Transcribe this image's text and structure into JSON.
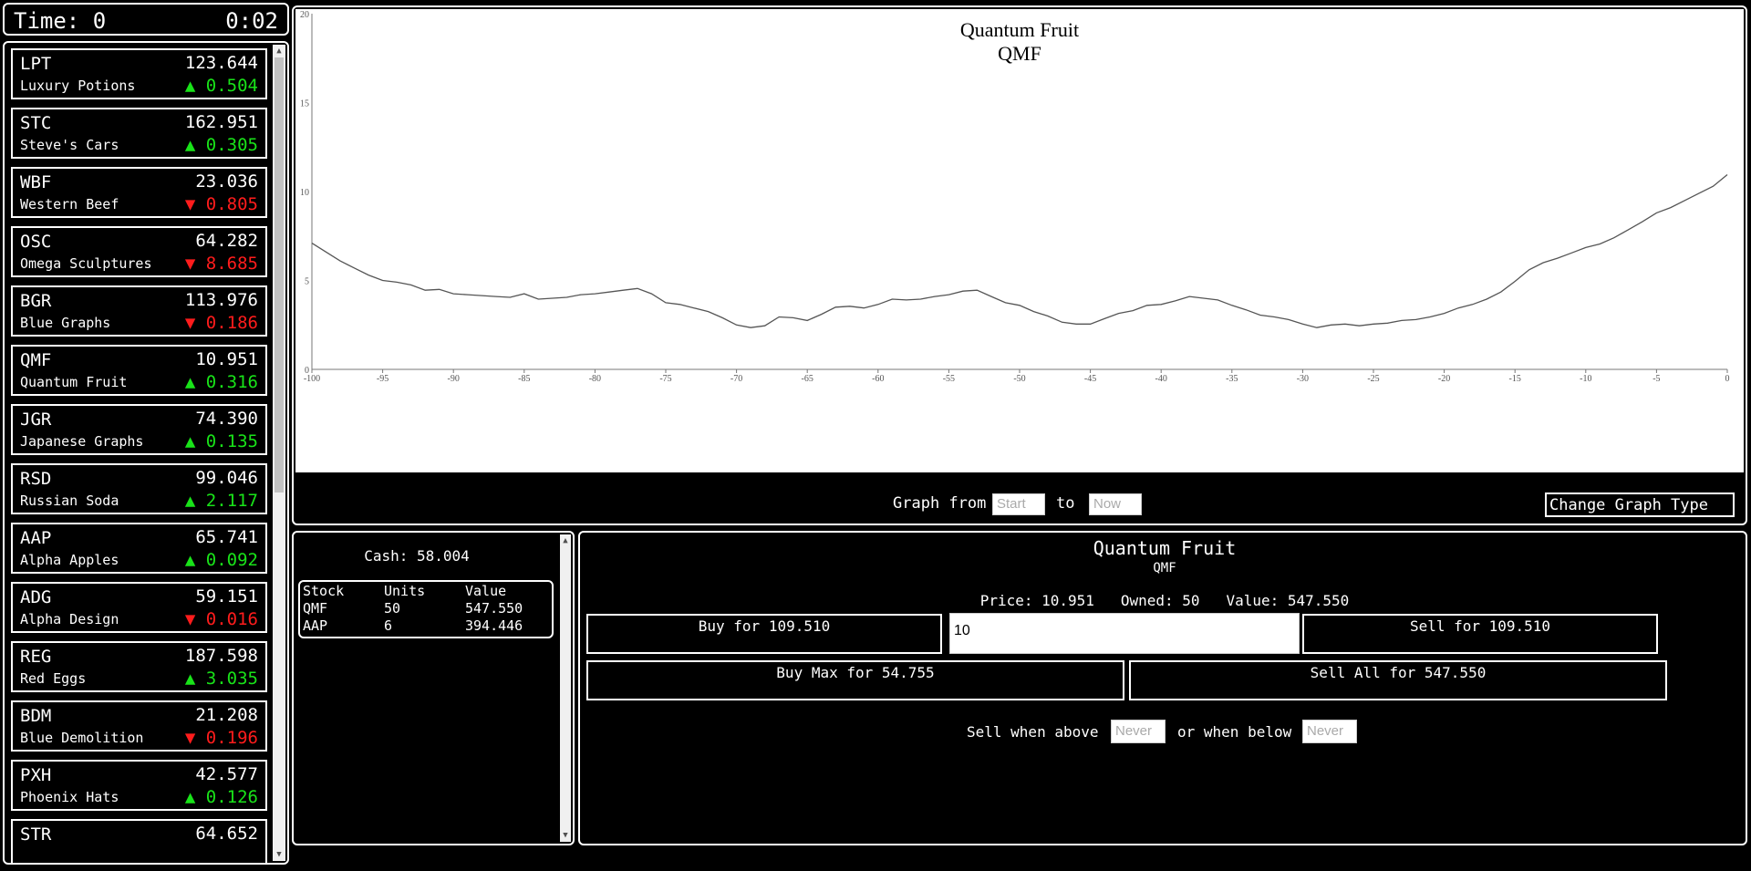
{
  "time": {
    "label": "Time: 0",
    "clock": "0:02"
  },
  "colors": {
    "up": "#19e319",
    "down": "#ff1c1c",
    "background": "#000000",
    "foreground": "#ffffff"
  },
  "stocks": [
    {
      "symbol": "LPT",
      "name": "Luxury Potions",
      "price": "123.644",
      "change": "0.504",
      "direction": "up"
    },
    {
      "symbol": "STC",
      "name": "Steve's Cars",
      "price": "162.951",
      "change": "0.305",
      "direction": "up"
    },
    {
      "symbol": "WBF",
      "name": "Western Beef",
      "price": "23.036",
      "change": "0.805",
      "direction": "down"
    },
    {
      "symbol": "OSC",
      "name": "Omega Sculptures",
      "price": "64.282",
      "change": "8.685",
      "direction": "down"
    },
    {
      "symbol": "BGR",
      "name": "Blue Graphs",
      "price": "113.976",
      "change": "0.186",
      "direction": "down"
    },
    {
      "symbol": "QMF",
      "name": "Quantum Fruit",
      "price": "10.951",
      "change": "0.316",
      "direction": "up"
    },
    {
      "symbol": "JGR",
      "name": "Japanese Graphs",
      "price": "74.390",
      "change": "0.135",
      "direction": "up"
    },
    {
      "symbol": "RSD",
      "name": "Russian Soda",
      "price": "99.046",
      "change": "2.117",
      "direction": "up"
    },
    {
      "symbol": "AAP",
      "name": "Alpha Apples",
      "price": "65.741",
      "change": "0.092",
      "direction": "up"
    },
    {
      "symbol": "ADG",
      "name": "Alpha Design",
      "price": "59.151",
      "change": "0.016",
      "direction": "down"
    },
    {
      "symbol": "REG",
      "name": "Red Eggs",
      "price": "187.598",
      "change": "3.035",
      "direction": "up"
    },
    {
      "symbol": "BDM",
      "name": "Blue Demolition",
      "price": "21.208",
      "change": "0.196",
      "direction": "down"
    },
    {
      "symbol": "PXH",
      "name": "Phoenix Hats",
      "price": "42.577",
      "change": "0.126",
      "direction": "up"
    },
    {
      "symbol": "STR",
      "name": "",
      "price": "64.652",
      "change": "",
      "direction": ""
    }
  ],
  "stock_list_scroll": {
    "thumb_fraction": 0.55,
    "position_fraction": 0.0
  },
  "chart_data": {
    "type": "line",
    "title": "Quantum Fruit",
    "subtitle": "QMF",
    "xlim": [
      -100,
      0
    ],
    "ylim": [
      0,
      20
    ],
    "xticks": [
      -100,
      -95,
      -90,
      -85,
      -80,
      -75,
      -70,
      -65,
      -60,
      -55,
      -50,
      -45,
      -40,
      -35,
      -30,
      -25,
      -20,
      -15,
      -10,
      -5,
      0
    ],
    "yticks": [
      0,
      5,
      10,
      15,
      20
    ],
    "grid": false,
    "series": [
      {
        "x": [
          -100,
          -99,
          -98,
          -97,
          -96,
          -95,
          -94,
          -93,
          -92,
          -91,
          -90,
          -89,
          -88,
          -87,
          -86,
          -85,
          -84,
          -83,
          -82,
          -81,
          -80,
          -79,
          -78,
          -77,
          -76,
          -75,
          -74,
          -73,
          -72,
          -71,
          -70,
          -69,
          -68,
          -67,
          -66,
          -65,
          -64,
          -63,
          -62,
          -61,
          -60,
          -59,
          -58,
          -57,
          -56,
          -55,
          -54,
          -53,
          -52,
          -51,
          -50,
          -49,
          -48,
          -47,
          -46,
          -45,
          -44,
          -43,
          -42,
          -41,
          -40,
          -39,
          -38,
          -37,
          -36,
          -35,
          -34,
          -33,
          -32,
          -31,
          -30,
          -29,
          -28,
          -27,
          -26,
          -25,
          -24,
          -23,
          -22,
          -21,
          -20,
          -19,
          -18,
          -17,
          -16,
          -15,
          -14,
          -13,
          -12,
          -11,
          -10,
          -9,
          -8,
          -7,
          -6,
          -5,
          -4,
          -3,
          -2,
          -1,
          0
        ],
        "y": [
          7.1,
          6.6,
          6.1,
          5.7,
          5.3,
          5.0,
          4.9,
          4.75,
          4.45,
          4.5,
          4.25,
          4.2,
          4.15,
          4.1,
          4.05,
          4.25,
          3.95,
          4.0,
          4.05,
          4.2,
          4.25,
          4.35,
          4.45,
          4.55,
          4.25,
          3.75,
          3.65,
          3.45,
          3.25,
          2.9,
          2.5,
          2.35,
          2.45,
          2.95,
          2.9,
          2.75,
          3.1,
          3.5,
          3.55,
          3.45,
          3.65,
          3.95,
          3.9,
          3.95,
          4.1,
          4.2,
          4.4,
          4.45,
          4.1,
          3.75,
          3.6,
          3.25,
          3.0,
          2.65,
          2.55,
          2.55,
          2.85,
          3.15,
          3.3,
          3.6,
          3.65,
          3.85,
          4.1,
          4.0,
          3.9,
          3.6,
          3.35,
          3.05,
          2.95,
          2.8,
          2.55,
          2.35,
          2.5,
          2.55,
          2.45,
          2.55,
          2.6,
          2.75,
          2.8,
          2.95,
          3.15,
          3.45,
          3.65,
          3.95,
          4.35,
          4.95,
          5.6,
          6.0,
          6.25,
          6.55,
          6.85,
          7.05,
          7.4,
          7.85,
          8.3,
          8.8,
          9.1,
          9.5,
          9.9,
          10.3,
          10.95
        ]
      }
    ]
  },
  "graph_controls": {
    "from_label": "Graph from",
    "from_placeholder": "Start",
    "to_label": "to",
    "to_placeholder": "Now",
    "change_type_label": "Change Graph Type"
  },
  "portfolio": {
    "cash": "Cash: 58.004",
    "headers": [
      "Stock",
      "Units",
      "Value"
    ],
    "rows": [
      [
        "QMF",
        "50",
        "547.550"
      ],
      [
        "AAP",
        "6",
        "394.446"
      ]
    ]
  },
  "trade": {
    "name": "Quantum Fruit",
    "symbol": "QMF",
    "price_text": "Price: 10.951",
    "owned_text": "Owned: 50",
    "value_text": "Value: 547.550",
    "buy_label": "Buy for 109.510",
    "quantity": "10",
    "sell_label": "Sell for 109.510",
    "buy_max_label": "Buy Max for 54.755",
    "sell_all_label": "Sell All for 547.550",
    "sell_above_label": "Sell when above",
    "sell_above_placeholder": "Never",
    "sell_below_label": "or when below",
    "sell_below_placeholder": "Never"
  }
}
